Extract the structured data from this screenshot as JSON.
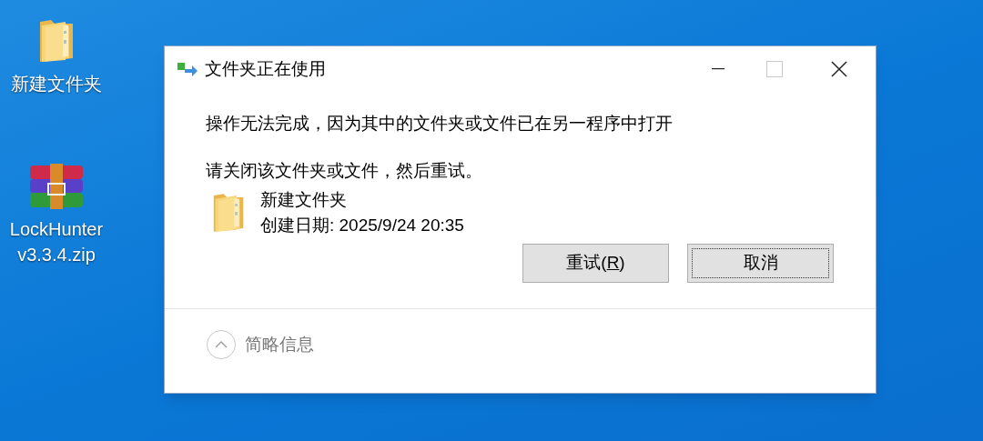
{
  "desktop_icons": [
    {
      "kind": "folder",
      "label": "新建文件夹"
    },
    {
      "kind": "archive",
      "label": "LockHunter v3.3.4.zip"
    }
  ],
  "dialog": {
    "title": "文件夹正在使用",
    "minimize_disabled": false,
    "maximize_disabled": true,
    "message": "操作无法完成，因为其中的文件夹或文件已在另一程序中打开",
    "instruction": "请关闭该文件夹或文件，然后重试。",
    "file": {
      "name": "新建文件夹",
      "created": "创建日期: 2025/9/24 20:35"
    },
    "buttons": [
      {
        "label_before": "重试(",
        "accesskey": "R",
        "label_after": ")",
        "focused": false
      },
      {
        "label_before": "取消",
        "focused": true
      }
    ],
    "details_toggle": {
      "label": "简略信息",
      "expanded": true
    }
  }
}
